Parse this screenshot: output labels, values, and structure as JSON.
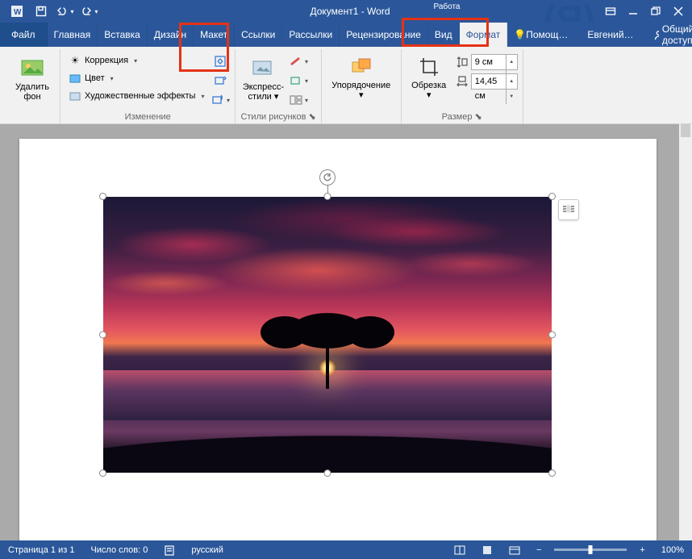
{
  "title": "Документ1 - Word",
  "context_tool": "Работа",
  "tabs": {
    "file": "Файл",
    "items": [
      "Главная",
      "Вставка",
      "Дизайн",
      "Макет",
      "Ссылки",
      "Рассылки",
      "Рецензирование",
      "Вид",
      "Формат"
    ],
    "active": "Формат",
    "tell_me": "Помощ…",
    "user": "Евгений…",
    "share": "Общий доступ"
  },
  "ribbon": {
    "remove_bg": {
      "l1": "Удалить",
      "l2": "фон"
    },
    "change": {
      "corrections": "Коррекция",
      "color": "Цвет",
      "effects": "Художественные эффекты",
      "label": "Изменение"
    },
    "styles": {
      "express": {
        "l1": "Экспресс-",
        "l2": "стили"
      },
      "label": "Стили рисунков"
    },
    "arrange": {
      "label_btn": "Упорядочение"
    },
    "size": {
      "crop": "Обрезка",
      "height": "9 см",
      "width": "14,45 см",
      "label": "Размер"
    }
  },
  "status": {
    "page": "Страница 1 из 1",
    "words": "Число слов: 0",
    "lang": "русский",
    "zoom": "100%"
  }
}
